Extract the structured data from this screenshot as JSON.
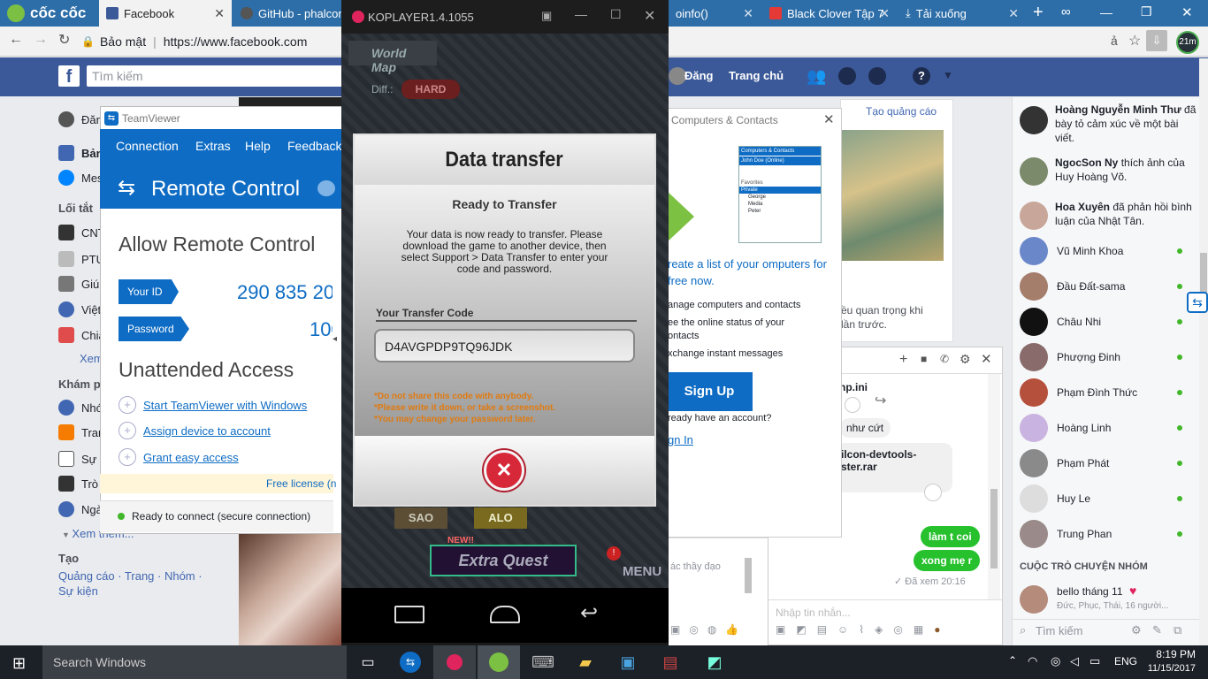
{
  "browser": {
    "tabs": [
      {
        "label": "cốc cốc",
        "kind": "brand"
      },
      {
        "label": "Facebook",
        "active": true
      },
      {
        "label": "GitHub - phalcon/"
      },
      {
        "label": "oinfo()"
      },
      {
        "label": "Black Clover Tập 7"
      },
      {
        "label": "Tải xuống"
      }
    ],
    "security_label": "Bảo mật",
    "url": "https://www.facebook.com",
    "badge": "21m"
  },
  "facebook": {
    "search_placeholder": "Tìm kiếm",
    "nav": {
      "user": "Đăng",
      "home": "Trang chủ"
    },
    "leftnav": {
      "user": "Đăn",
      "items_top": [
        "Bản",
        "Mes"
      ],
      "shortcuts_title": "Lối tắt",
      "shortcuts": [
        "CNT",
        "PTU",
        "Giúp",
        "Việt",
        "Chia"
      ],
      "see_more_1": "Xem",
      "explore_title": "Khám p",
      "explore": [
        "Nhó",
        "Tran",
        "Sự",
        "Trò",
        "Ngà"
      ],
      "see_more_2": "Xem thêm...",
      "create_title": "Tạo",
      "create_links": "Quảng cáo · Trang · Nhóm · Sự kiện"
    },
    "ads": {
      "create_ad": "Tạo quảng cáo",
      "partial_text": "ều quan trọng khi lần trước."
    },
    "ticker": [
      {
        "name": "Hoàng Nguyễn Minh Thư",
        "text": "đã bày tỏ cảm xúc về một bài viết."
      },
      {
        "name": "NgocSon Ny",
        "text": "thích ảnh của Huy Hoàng Võ."
      },
      {
        "name": "Hoa Xuyên",
        "text": "đã phản hồi bình luận của Nhật Tân."
      }
    ],
    "contacts": [
      "Vũ Minh Khoa",
      "Đầu Đất-sama",
      "Châu Nhi",
      "Phượng Đinh",
      "Phạm Đình Thức",
      "Hoàng Linh",
      "Phạm Phát",
      "Huy Le",
      "Trung Phan"
    ],
    "group_title": "CUỘC TRÒ CHUYỆN NHÓM",
    "group": {
      "name": "bello tháng 11",
      "members": "Đức, Phục, Thái, 16 người..."
    },
    "contact_search": "Tìm kiếm",
    "chat": {
      "file1": "hp.ini",
      "msg1": "như cứt",
      "file2": "ilcon-devtools-\nster.rar",
      "out1": "làm t coi",
      "out2": "xong mẹ r",
      "seen": "✓ Đã xem 20:16",
      "input_placeholder": "Nhập tin nhắn...",
      "behind_text": "ác thầy đạo"
    }
  },
  "teamviewer": {
    "title": "TeamViewer",
    "menu": [
      "Connection",
      "Extras",
      "Help",
      "Feedback"
    ],
    "header": "Remote Control",
    "allow_title": "Allow Remote Control",
    "id_label": "Your ID",
    "id_value": "290 835 20",
    "pw_label": "Password",
    "pw_value": "100",
    "unattended_title": "Unattended Access",
    "links": [
      "Start TeamViewer with Windows",
      "Assign device to account",
      "Grant easy access"
    ],
    "license": "Free license (n",
    "status": "Ready to connect (secure connection)"
  },
  "computers_contacts": {
    "title": "Computers & Contacts",
    "mini_title": "Computers & Contacts",
    "mini_user": "John Doe (Online)",
    "mini_group": "Private",
    "mini_names": [
      "George",
      "Media",
      "Peter"
    ],
    "mini_favorites": "Favorites",
    "headline": "reate a list of your omputers for free now.",
    "bullets": [
      "anage computers and contacts",
      "ee the online status of your ontacts",
      "xchange instant messages"
    ],
    "signup": "Sign Up",
    "already": "ready have an account?",
    "signin": "gn In"
  },
  "koplayer": {
    "title": "KOPLAYER1.4.1055",
    "bg_worldmap": "World Map",
    "bg_diff": "Diff.:",
    "bg_hard": "HARD",
    "bg_extra": "Extra Quest",
    "bg_new": "NEW!!",
    "bg_menu": "MENU",
    "bg_sao": "SAO",
    "bg_alo": "ALO",
    "dialog_title": "Data transfer",
    "ready": "Ready to Transfer",
    "body": "Your data is now ready to transfer. Please download the game to another device, then select Support > Data Transfer to enter your code and password.",
    "code_label": "Your Transfer Code",
    "code": "D4AVGPDP9TQ96JDK",
    "warnings": [
      "*Do not share this code with anybody.",
      "*Please write it down, or take a screenshot.",
      "*You may change your password later."
    ]
  },
  "taskbar": {
    "search": "Search Windows",
    "lang": "ENG",
    "time": "8:19 PM",
    "date": "11/15/2017"
  }
}
